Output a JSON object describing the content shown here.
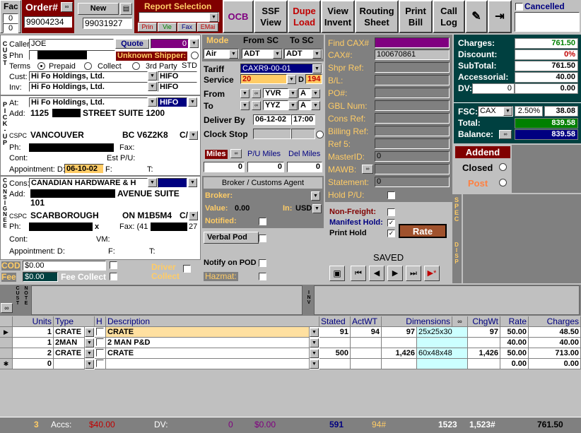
{
  "fac": {
    "label": "Fac",
    "values": [
      "0",
      "0"
    ]
  },
  "order": {
    "label": "Order#",
    "value": "99004234"
  },
  "new_order": {
    "label": "New",
    "value": "99031927"
  },
  "report": {
    "label": "Report Selection",
    "buttons": [
      "Prin",
      "Vie",
      "Fax",
      "EMai"
    ]
  },
  "toolbar": {
    "ocb": "OCB",
    "ssf": [
      "SSF",
      "View"
    ],
    "dupe": [
      "Dupe",
      "Load"
    ],
    "view": [
      "View",
      "Invent"
    ],
    "routing": [
      "Routing",
      "Sheet"
    ],
    "print": [
      "Print",
      "Bill"
    ],
    "call": [
      "Call",
      "Log"
    ],
    "cancelled": "Cancelled"
  },
  "customer": {
    "side": "CUST",
    "caller_label": "Caller",
    "caller": "JOE",
    "quote": "Quote",
    "quote_num": "0",
    "phn_label": "Phn",
    "unknown": "Unknown Shipper:",
    "terms_label": "Terms",
    "terms": [
      "Prepaid",
      "Collect",
      "3rd Party"
    ],
    "std": "STD",
    "cust_label": "Cust:",
    "cust": "Hi Fo Holdings, Ltd.",
    "cust_code": "HIFO",
    "inv_label": "Inv:",
    "inv": "Hi Fo Holdings, Ltd.",
    "inv_code": "HIFO"
  },
  "pickup": {
    "side": "PICK-UP",
    "at_label": "At:",
    "at": "Hi Fo Holdings, Ltd.",
    "at_code": "HIFO",
    "add_label": "Add:",
    "add_a": "1125",
    "add_b": "STREET SUITE 1200",
    "cspc": "CSPC",
    "city": "VANCOUVER",
    "prov": "BC V6Z2K8",
    "cntry": "C/",
    "ph": "Ph:",
    "fax": "Fax:",
    "cont": "Cont:",
    "estpu": "Est P/U:",
    "appt": "Appointment: D:",
    "appt_date": "06-10-02",
    "f": "F:",
    "t": "T:"
  },
  "consignee": {
    "side": "CONSIGNEE",
    "cons_label": "Cons:",
    "cons": "CANADIAN HARDWARE & H",
    "add_label": "Add:",
    "add_b": "AVENUE SUITE",
    "add_2": "101",
    "cspc": "CSPC",
    "city": "SCARBOROUGH",
    "prov": "ON M1B5M4",
    "cntry": "C/",
    "ph": "Ph:",
    "ph_tail": "x",
    "fax": "Fax: (41",
    "fax_tail": "27",
    "cont": "Cont:",
    "vm": "VM:",
    "appt": "Appointment: D:",
    "f": "F:",
    "t": "T:"
  },
  "cod": {
    "cod": "COD",
    "cod_val": "$0.00",
    "fee": "Fee",
    "fee_val": "$0.00",
    "fee_collect": "Fee Collect",
    "driver_collect": [
      "Driver",
      "Collect"
    ]
  },
  "mode": {
    "mode": "Mode",
    "from_sc": "From SC",
    "to_sc": "To SC",
    "mode_val": "Air",
    "from_val": "ADT",
    "to_val": "ADT",
    "tariff": "Tariff",
    "tariff_val": "CAXR9-00-01",
    "service": "Service",
    "service_val": "20",
    "d": "D",
    "d_val": "194",
    "from": "From",
    "from_val2": "YVR",
    "to": "To",
    "to_val2": "YYZ",
    "from_a": "A",
    "to_a": "A",
    "deliver": "Deliver By",
    "deliver_date": "06-12-02",
    "deliver_time": "17:00",
    "clock": "Clock Stop"
  },
  "miles": {
    "miles": "Miles",
    "pu": "P/U Miles",
    "del": "Del Miles",
    "values": [
      "0",
      "0",
      "0"
    ]
  },
  "broker": {
    "title": "Broker / Customs Agent",
    "broker": "Broker:",
    "value": "Value:",
    "value_val": "0.00",
    "in": "In:",
    "in_val": "USD",
    "notified": "Notified:"
  },
  "pod": {
    "verbal": "Verbal Pod",
    "notify": "Notify on POD",
    "hazmat": "Hazmat:"
  },
  "refs": {
    "find": "Find CAX#",
    "cax": "CAX#:",
    "cax_val": "100670861",
    "shpr": "Shpr Ref:",
    "bl": "B/L:",
    "po": "PO#:",
    "gbl": "GBL Num:",
    "cons": "Cons Ref:",
    "billing": "Billing Ref:",
    "ref5": "Ref 5:",
    "master": "MasterID:",
    "master_val": "0",
    "mawb": "MAWB:",
    "statement": "Statement:",
    "statement_val": "0",
    "hold": "Hold P/U:"
  },
  "flags": {
    "nonfreight": "Non-Freight:",
    "manifest": "Manifest Hold:",
    "print_hold": "Print Hold",
    "rate": "Rate",
    "spec": "SPEC",
    "disp": "DISP"
  },
  "nav": {
    "saved": "SAVED"
  },
  "charges": {
    "charges": "Charges:",
    "charges_val": "761.50",
    "discount": "Discount:",
    "discount_val": "0%",
    "subtotal": "SubTotal:",
    "subtotal_val": "761.50",
    "accessorial": "Accessorial:",
    "accessorial_val": "40.00",
    "dv": "DV:",
    "dv_a": "0",
    "dv_b": "0.00",
    "fsc": "FSC:",
    "fsc_cur": "CAX",
    "fsc_pct": "2.50%",
    "fsc_val": "38.08",
    "total": "Total:",
    "total_val": "839.58",
    "balance": "Balance:",
    "balance_val": "839.58"
  },
  "status": {
    "addend": "Addend",
    "closed": "Closed",
    "post": "Post"
  },
  "custnote": {
    "side": "CUST NOTE",
    "inv": "INV"
  },
  "grid": {
    "headers": [
      "Units",
      "Type",
      "H",
      "Description",
      "Stated",
      "ActWT",
      "Dimensions",
      "ChgWt",
      "Rate",
      "Charges"
    ],
    "rows": [
      {
        "units": "1",
        "type": "CRATE",
        "desc": "CRATE",
        "stated": "91",
        "actwt": "94",
        "dimw": "97",
        "dims": "25x25x30",
        "chgwt": "97",
        "rate": "50.00",
        "charges": "48.50"
      },
      {
        "units": "1",
        "type": "2MAN",
        "desc": "2 MAN P&D",
        "stated": "",
        "actwt": "",
        "dimw": "",
        "dims": "",
        "chgwt": "",
        "rate": "40.00",
        "charges": "40.00"
      },
      {
        "units": "2",
        "type": "CRATE",
        "desc": "CRATE",
        "stated": "500",
        "actwt": "",
        "dimw": "1,426",
        "dims": "60x48x48",
        "chgwt": "1,426",
        "rate": "50.00",
        "charges": "713.00"
      },
      {
        "units": "0",
        "type": "",
        "desc": "",
        "stated": "",
        "actwt": "",
        "dimw": "",
        "dims": "",
        "chgwt": "",
        "rate": "0.00",
        "charges": "0.00"
      }
    ]
  },
  "footer": {
    "count": "3",
    "accs": "Accs:",
    "accs_val": "$40.00",
    "dv": "DV:",
    "dv_val": "0",
    "dv_amt": "$0.00",
    "stated": "591",
    "actwt": "94#",
    "dimw": "1523",
    "chgwt": "1,523#",
    "total": "761.50"
  },
  "colors": {
    "panel_dark": "#004040",
    "maroon": "#800000",
    "accent_red": "#c00000",
    "tan_text": "#ffcc66"
  }
}
